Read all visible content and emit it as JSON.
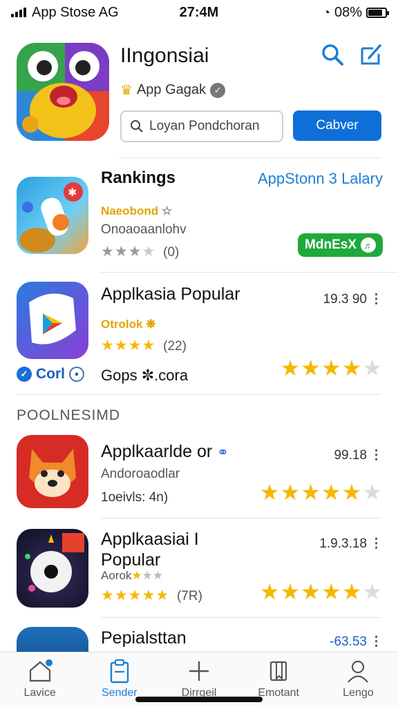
{
  "status_bar": {
    "carrier": "App Stose AG",
    "time": "27:4M",
    "battery_pct": "08%"
  },
  "hero": {
    "title": "IIngonsiai",
    "subtitle": "App Gagak",
    "search_placeholder": "Loyan Pondchoran",
    "button_label": "Cabver"
  },
  "rankings": {
    "heading": "Rankings",
    "link": "AppStonn 3 Lalary",
    "dev": "Naeobond",
    "desc": "Onoaoaanlohv",
    "rating_count": "(0)",
    "badge": "MdnEsX"
  },
  "popular": {
    "title": "Applkasia Popular",
    "price": "19.3 90",
    "dev": "Otrolok",
    "rating_count": "(22)",
    "brand1": "Corl",
    "brand2": "Gops",
    "brand2_suffix": ".cora"
  },
  "section": {
    "heading": "POOLNESIMD"
  },
  "item3": {
    "title": "Applkaarlde or",
    "price": "99.18",
    "desc": "Andoroaodlar",
    "sub": "1oeivls: 4n)"
  },
  "item4": {
    "title_l1": "Applkaasiai I",
    "title_l2": "Popular",
    "price": "1.9.3.18",
    "dev": "Aorok",
    "rating_count": "(7R)"
  },
  "item5": {
    "title": "Pepialsttan",
    "price": "-63.53"
  },
  "tabs": [
    {
      "label": "Lavice"
    },
    {
      "label": "Sender"
    },
    {
      "label": "Dirrgeil"
    },
    {
      "label": "Emotant"
    },
    {
      "label": "Lengo"
    }
  ],
  "colors": {
    "accent": "#1a7fd6",
    "button": "#0f6fd9",
    "star": "#f5b800",
    "badge": "#20a83c"
  }
}
